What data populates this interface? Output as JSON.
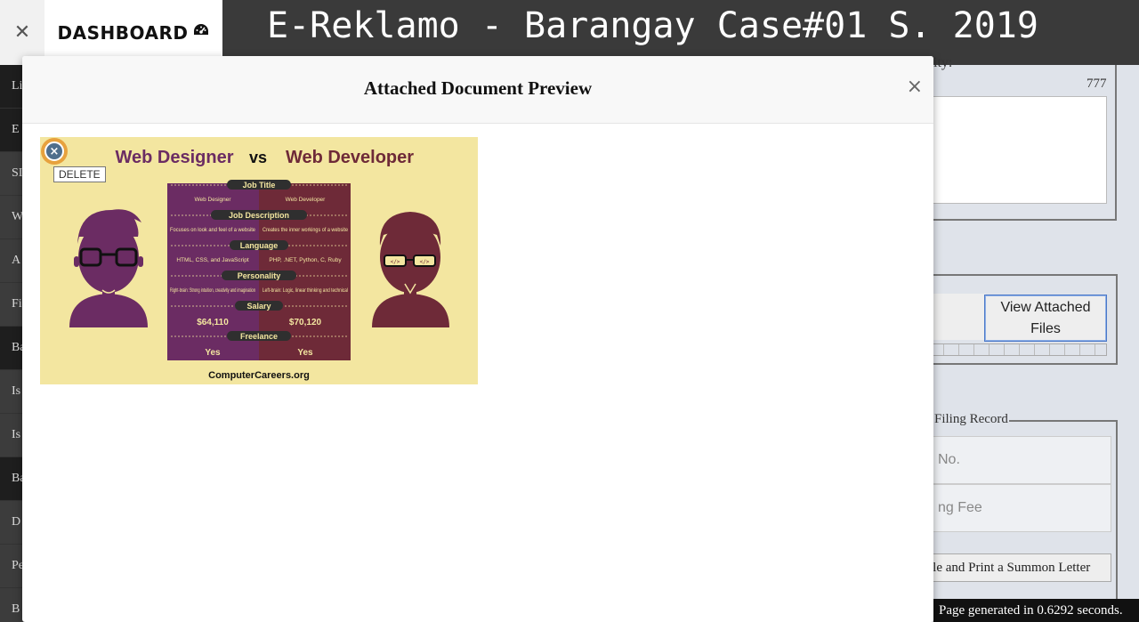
{
  "topbar": {
    "close_icon": "✕",
    "dashboard_label": "DASHBOARD",
    "dashboard_icon": "tachometer-icon",
    "app_title": "E-Reklamo - Barangay Case#01 S. 2019"
  },
  "sidebar": {
    "items": [
      {
        "label": "Li",
        "dark": true
      },
      {
        "label": "E",
        "dark": true
      },
      {
        "label": "SI",
        "dark": false
      },
      {
        "label": "W",
        "dark": false
      },
      {
        "label": "A",
        "dark": false
      },
      {
        "label": "Fi",
        "dark": false
      },
      {
        "label": "Ba",
        "dark": true
      },
      {
        "label": "Is",
        "dark": false
      },
      {
        "label": "Is",
        "dark": false
      },
      {
        "label": "Ba",
        "dark": true
      },
      {
        "label": "D",
        "dark": false
      },
      {
        "label": "Pe",
        "dark": false
      },
      {
        "label": "B",
        "dark": false
      }
    ]
  },
  "background_form": {
    "label_partial": "ity:",
    "char_count": "777",
    "view_attached_files": "View Attached Files",
    "filing_record_legend": "Filing Record",
    "field_no": "No.",
    "field_fee": "ng Fee",
    "summon_button": "ile and Print a Summon Letter",
    "footer_text": "Page generated in 0.6292 seconds."
  },
  "modal": {
    "title": "Attached Document Preview",
    "close_label": "×",
    "delete_tooltip": "DELETE",
    "delete_icon_glyph": "×"
  },
  "attachment": {
    "title_left": "Web Designer",
    "title_vs": "vs",
    "title_right": "Web Developer",
    "rows": [
      {
        "header": "Job Title",
        "left": "Web Designer",
        "right": "Web Developer"
      },
      {
        "header": "Job Description",
        "left": "Focuses on look and feel of a website",
        "right": "Creates the inner workings of a website"
      },
      {
        "header": "Language",
        "left": "HTML, CSS, and JavaScript",
        "right": "PHP, .NET, Python, C, Ruby"
      },
      {
        "header": "Personality",
        "left": "Right-brain: Strong intuition, creativity and imagination",
        "right": "Left-brain: Logic, linear thinking and technical"
      },
      {
        "header": "Salary",
        "left": "$64,110",
        "right": "$70,120"
      },
      {
        "header": "Freelance",
        "left": "Yes",
        "right": "Yes"
      }
    ],
    "footer": "ComputerCareers.org",
    "colors": {
      "background": "#f3e6a0",
      "designer_purple": "#6b2c63",
      "developer_maroon": "#6e2a38",
      "header_pill": "#2f2f2f"
    }
  }
}
